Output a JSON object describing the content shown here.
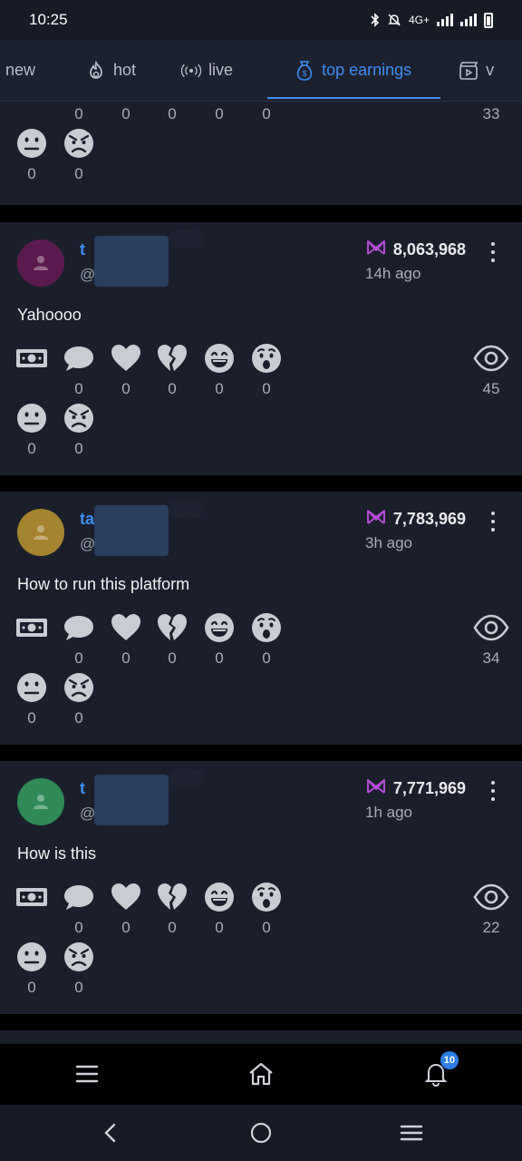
{
  "status_bar": {
    "time": "10:25",
    "network": "4G+"
  },
  "tabs": [
    {
      "label": "new",
      "icon": "none"
    },
    {
      "label": "hot",
      "icon": "fire-icon"
    },
    {
      "label": "live",
      "icon": "broadcast-icon"
    },
    {
      "label": "top earnings",
      "icon": "money-bag-icon",
      "active": true
    },
    {
      "label": "v",
      "icon": "clapperboard-icon"
    }
  ],
  "reaction_icons": [
    "money-icon",
    "comment-icon",
    "heart-icon",
    "broken-heart-icon",
    "laugh-icon",
    "wow-icon",
    "neutral-icon",
    "angry-icon"
  ],
  "partial_card": {
    "reactions": [
      "0",
      "0",
      "0",
      "0",
      "0",
      "0",
      "0"
    ],
    "views": "33"
  },
  "posts": [
    {
      "avatar_color": "#5b1a4e",
      "username": "t",
      "handle": "@",
      "earnings": "8,063,968",
      "time_ago": "14h ago",
      "text": "Yahoooo",
      "reactions": [
        "0",
        "0",
        "0",
        "0",
        "0",
        "0",
        "0"
      ],
      "views": "45"
    },
    {
      "avatar_color": "#a4842e",
      "username": "ta",
      "handle": "@",
      "earnings": "7,783,969",
      "time_ago": "3h ago",
      "text": "How to run this platform",
      "reactions": [
        "0",
        "0",
        "0",
        "0",
        "0",
        "0",
        "0"
      ],
      "views": "34"
    },
    {
      "avatar_color": "#2f8a56",
      "username": "t",
      "handle": "@",
      "earnings": "7,771,969",
      "time_ago": "1h ago",
      "text": "How is this",
      "reactions": [
        "0",
        "0",
        "0",
        "0",
        "0",
        "0",
        "0"
      ],
      "views": "22"
    }
  ],
  "bottom_nav": {
    "notification_count": "10"
  },
  "colors": {
    "accent": "#3d8ff0",
    "earnings_icon": "#b44ad6",
    "card_bg": "#1b1f2c"
  }
}
